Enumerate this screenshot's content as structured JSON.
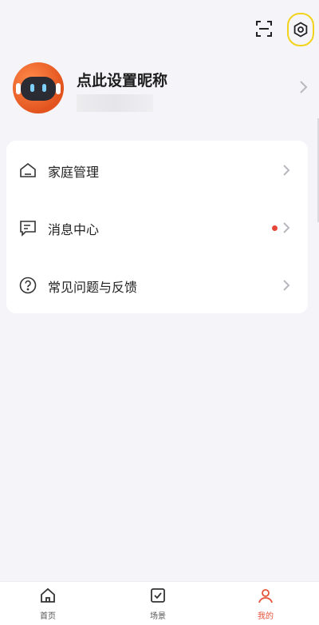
{
  "profile": {
    "nickname": "点此设置昵称"
  },
  "menu": {
    "items": [
      {
        "label": "家庭管理",
        "icon": "home-icon"
      },
      {
        "label": "消息中心",
        "icon": "message-icon",
        "badge": true
      },
      {
        "label": "常见问题与反馈",
        "icon": "help-icon"
      }
    ]
  },
  "tabbar": {
    "tabs": [
      {
        "label": "首页",
        "icon": "home-icon"
      },
      {
        "label": "场景",
        "icon": "scene-check-icon"
      },
      {
        "label": "我的",
        "icon": "profile-icon",
        "active": true
      }
    ]
  },
  "colors": {
    "background": "#f5f4f9",
    "highlight": "#f2d31b",
    "badge": "#e5473b",
    "active_tab": "#e5533b"
  }
}
